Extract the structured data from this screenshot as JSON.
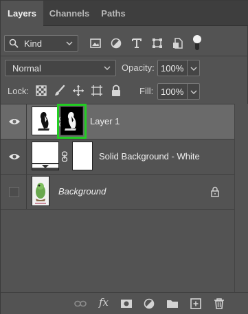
{
  "tabs": [
    {
      "label": "Layers",
      "active": true
    },
    {
      "label": "Channels",
      "active": false
    },
    {
      "label": "Paths",
      "active": false
    }
  ],
  "filter": {
    "kind_label": "Kind",
    "icons": [
      "image-filter-icon",
      "adjustment-filter-icon",
      "type-filter-icon",
      "shape-filter-icon",
      "smart-object-filter-icon"
    ],
    "toggle_on": true
  },
  "blend": {
    "mode": "Normal",
    "opacity_label": "Opacity:",
    "opacity_value": "100%"
  },
  "lock": {
    "label": "Lock:",
    "icons": [
      "lock-transparent-pixels-icon",
      "lock-image-pixels-icon",
      "lock-position-icon",
      "prevent-auto-nesting-icon",
      "lock-all-icon"
    ],
    "fill_label": "Fill:",
    "fill_value": "100%"
  },
  "layers": [
    {
      "name": "Layer 1",
      "visible": true,
      "selected": true,
      "has_mask": true,
      "mask_highlighted": true
    },
    {
      "name": "Solid Background - White",
      "visible": true,
      "selected": false,
      "has_mask": true,
      "mask_highlighted": false
    },
    {
      "name": "Background",
      "visible": false,
      "selected": false,
      "locked": true,
      "italic": true
    }
  ],
  "bottom_bar": {
    "fx_label": "fx",
    "icons": [
      "link-layers-icon",
      "layer-style-icon",
      "add-mask-icon",
      "adjustment-layer-icon",
      "new-group-icon",
      "new-layer-icon",
      "delete-layer-icon"
    ]
  },
  "colors": {
    "panel_bg": "#535353",
    "selected_row": "#6a6a6a",
    "mask_highlight": "#22cc22"
  }
}
